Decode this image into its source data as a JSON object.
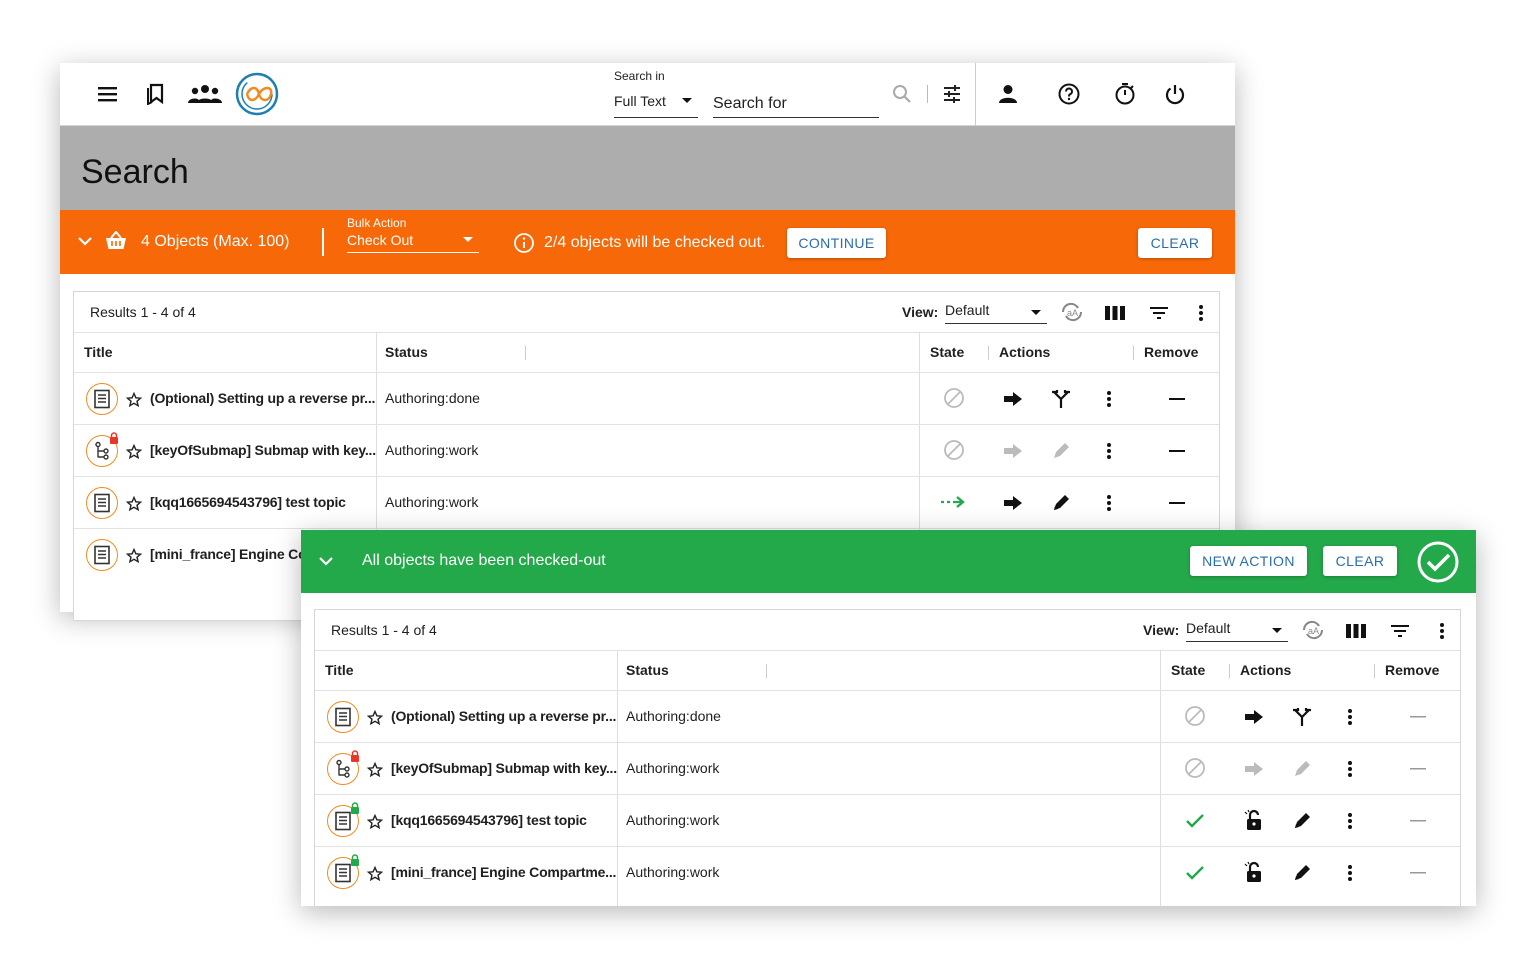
{
  "header": {
    "search_in_label": "Search in",
    "search_in_value": "Full Text",
    "search_placeholder": "Search for"
  },
  "page": {
    "title": "Search"
  },
  "bulk_bar": {
    "count_label": "4 Objects (Max. 100)",
    "action_label": "Bulk Action",
    "action_value": "Check Out",
    "info": "2/4 objects will be checked out.",
    "continue_label": "CONTINUE",
    "clear_label": "CLEAR",
    "color": "#f76808"
  },
  "success_bar": {
    "message": "All objects have been checked-out",
    "new_action_label": "NEW ACTION",
    "clear_label": "CLEAR",
    "color": "#23a84a"
  },
  "results": {
    "summary": "Results 1 - 4 of 4",
    "view_label": "View:",
    "view_value": "Default",
    "columns": {
      "title": "Title",
      "status": "Status",
      "state": "State",
      "actions": "Actions",
      "remove": "Remove"
    }
  },
  "table1": [
    {
      "title": "(Optional) Setting up a reverse pr...",
      "status": "Authoring:done",
      "type": "topic",
      "state": "disabled",
      "action": "split-icon"
    },
    {
      "title": "[keyOfSubmap] Submap with key...",
      "status": "Authoring:work",
      "type": "map",
      "lock": "red",
      "state": "disabled",
      "action": "pencil-icon-disabled"
    },
    {
      "title": "[kqq1665694543796] test topic",
      "status": "Authoring:work",
      "type": "topic",
      "state": "arrow",
      "action": "pencil-icon"
    },
    {
      "title": "[mini_france] Engine Cor",
      "status": "",
      "type": "topic",
      "state": "",
      "action": ""
    }
  ],
  "table2": [
    {
      "title": "(Optional) Setting up a reverse pr...",
      "status": "Authoring:done",
      "type": "topic",
      "state": "disabled",
      "action": "split-icon"
    },
    {
      "title": "[keyOfSubmap] Submap with key...",
      "status": "Authoring:work",
      "type": "map",
      "lock": "red",
      "state": "disabled",
      "action": "pencil-icon-disabled"
    },
    {
      "title": "[kqq1665694543796] test topic",
      "status": "Authoring:work",
      "type": "topic",
      "lock": "green",
      "state": "check",
      "action": "pencil-icon"
    },
    {
      "title": "[mini_france] Engine Compartme...",
      "status": "Authoring:work",
      "type": "topic",
      "lock": "green",
      "state": "check",
      "action": "pencil-icon"
    }
  ]
}
